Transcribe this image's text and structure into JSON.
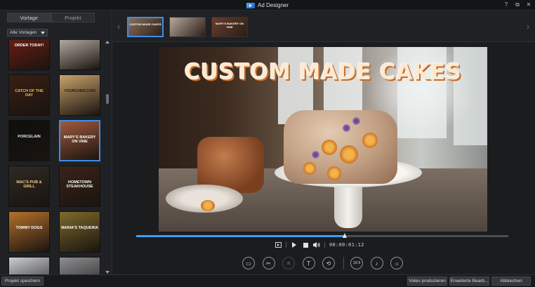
{
  "window": {
    "title": "Ad Designer",
    "controls": {
      "help": "?",
      "restore": "⧉",
      "close": "✕"
    }
  },
  "sidebar": {
    "tabs": [
      {
        "label": "Vorlage",
        "active": true
      },
      {
        "label": "Projekt",
        "active": false
      }
    ],
    "filter": {
      "value": "Alle Vorlagen"
    },
    "templates": [
      {
        "text": "ORDER TODAY!",
        "bg": "#7a1f12",
        "fg": "#ffffff"
      },
      {
        "text": "",
        "bg": "#d7ccc2",
        "fg": "#ffffff"
      },
      {
        "text": "CATCH OF THE DAY",
        "bg": "#3a1e14",
        "fg": "#f0c040"
      },
      {
        "text": "YOURCHEF.COM",
        "bg": "#c9a36a",
        "fg": "#2a1a0e"
      },
      {
        "text": "PORCELAIN",
        "bg": "#0d0f0d",
        "fg": "#e8e8e8"
      },
      {
        "text": "MARY'S BAKERY ON VINE",
        "bg": "#a05a3c",
        "fg": "#ffffff",
        "selected": true
      },
      {
        "text": "MAC'S PUB & GRILL",
        "bg": "#2f2a24",
        "fg": "#f2d18a"
      },
      {
        "text": "HOMETOWN STEAKHOUSE",
        "bg": "#3a2318",
        "fg": "#ffffff"
      },
      {
        "text": "TOMMY DOGS",
        "bg": "#b5702a",
        "fg": "#ffffff"
      },
      {
        "text": "MARIA'S TAQUERIA",
        "bg": "#7d6a2a",
        "fg": "#ffffff"
      },
      {
        "text": "",
        "bg": "#c9cdd2",
        "fg": "#ffffff"
      },
      {
        "text": "",
        "bg": "#8d8f92",
        "fg": "#ffffff"
      }
    ]
  },
  "scenes": [
    {
      "label": "CUSTOM MADE CAKES",
      "bg": "#8a6f5c",
      "selected": true
    },
    {
      "label": "",
      "bg": "#b7a89a",
      "selected": false
    },
    {
      "label": "MARY'S BAKERY ON VINE",
      "bg": "#6a3d2b",
      "selected": false
    }
  ],
  "preview": {
    "headline": "CUSTOM MADE CAKES",
    "progress": 0.56
  },
  "playback": {
    "timecode": "00:00:01:12",
    "icons": [
      "clip-mark-icon",
      "play-icon",
      "stop-icon",
      "volume-icon"
    ]
  },
  "tools": [
    {
      "name": "media-tool-icon",
      "glyph": "▭"
    },
    {
      "name": "trim-tool-icon",
      "glyph": "✂"
    },
    {
      "name": "crop-tool-icon",
      "glyph": "⧈",
      "disabled": true
    },
    {
      "name": "title-tool-icon",
      "glyph": "T"
    },
    {
      "name": "transition-tool-icon",
      "glyph": "⟲"
    },
    {
      "name": "aspect-ratio-tool-icon",
      "glyph": "16:9"
    },
    {
      "name": "music-tool-icon",
      "glyph": "♪"
    },
    {
      "name": "settings-tool-icon",
      "glyph": "☼"
    }
  ],
  "footer": {
    "save_project": "Projekt speichern",
    "produce_video": "Video produzieren",
    "advanced_edit": "Erweiterte Bearb...",
    "cancel": "Abbrechen"
  },
  "colors": {
    "accent": "#3c8ee8",
    "title_text": "#fbe9d2",
    "title_shadow": "#c56b2a"
  }
}
